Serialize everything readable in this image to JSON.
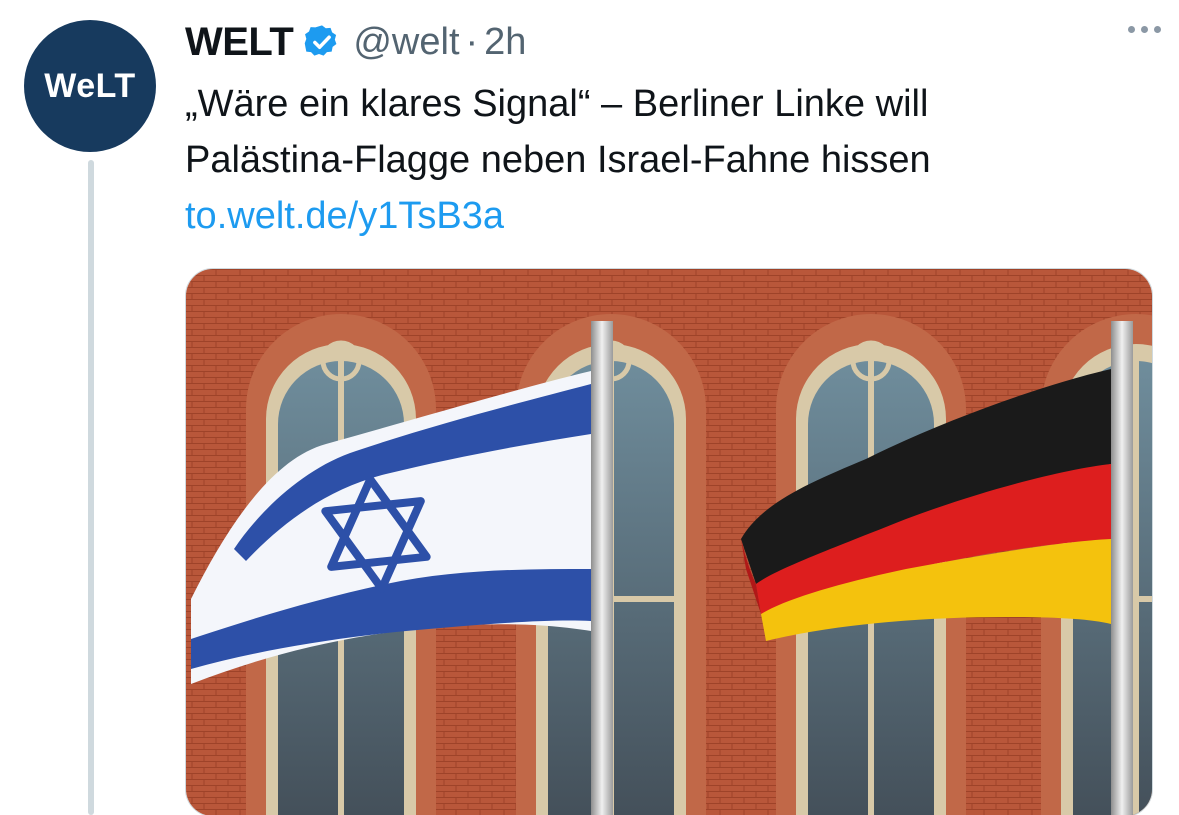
{
  "tweet": {
    "author_name": "WELT",
    "handle": "@welt",
    "separator": "·",
    "time": "2h",
    "avatar_text": "WeLT",
    "text_line1": "„Wäre ein klares Signal“ – Berliner Linke will",
    "text_line2": "Palästina-Flagge neben Israel-Fahne hissen",
    "link": "to.welt.de/y1TsB3a"
  },
  "icons": {
    "verified": "verified-badge-icon",
    "more": "more-options-icon"
  },
  "colors": {
    "avatar_bg": "#173a5e",
    "link": "#1d9bf0",
    "verified": "#1d9bf0",
    "brick": "#b84f33",
    "israel_blue": "#2d50a8",
    "germany_black": "#1a1a1a",
    "germany_red": "#dd1e1e",
    "germany_gold": "#f4c20d"
  }
}
